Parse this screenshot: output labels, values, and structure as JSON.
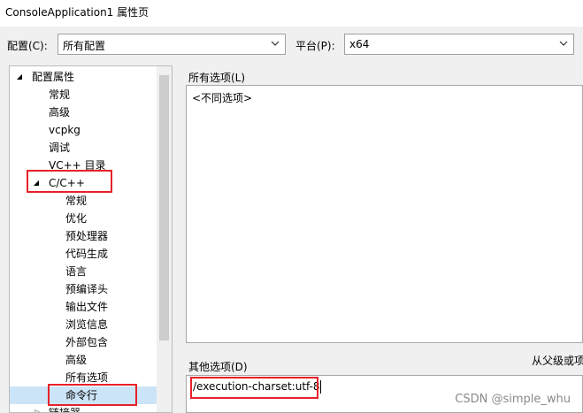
{
  "window": {
    "title": "ConsoleApplication1 属性页"
  },
  "config": {
    "config_label": "配置(C):",
    "config_value": "所有配置",
    "platform_label": "平台(P):",
    "platform_value": "x64"
  },
  "tree": {
    "root": "配置属性",
    "items": [
      "常规",
      "高级",
      "vcpkg",
      "调试",
      "VC++ 目录"
    ],
    "cpp_group": "C/C++",
    "cpp_items": [
      "常规",
      "优化",
      "预处理器",
      "代码生成",
      "语言",
      "预编译头",
      "输出文件",
      "浏览信息",
      "外部包含",
      "高级",
      "所有选项",
      "命令行"
    ],
    "linker": "链接器"
  },
  "main": {
    "all_options_label": "所有选项(L)",
    "all_options_value": "<不同选项>",
    "other_options_label": "其他选项(D)",
    "inherit_label": "从父级或项",
    "other_options_value": "/execution-charset:utf-8"
  },
  "watermark": "CSDN @simple_whu",
  "colors": {
    "highlight_red": "#e8202a",
    "selection_bg": "#cce4f7"
  }
}
